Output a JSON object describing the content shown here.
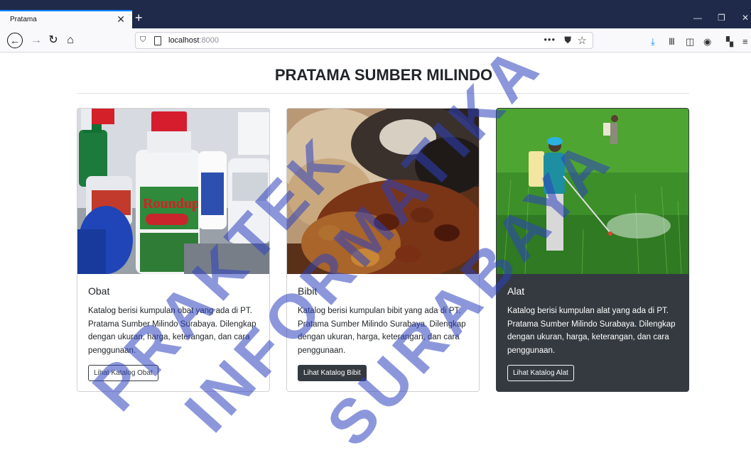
{
  "browser": {
    "tab_title": "Pratama",
    "url_host": "localhost",
    "url_port": ":8000",
    "accent": "#0a84ff"
  },
  "page": {
    "title": "PRATAMA SUMBER MILINDO"
  },
  "cards": [
    {
      "title": "Obat",
      "text": "Katalog berisi kumpulan obat yang ada di PT. Pratama Sumber Milindo Surabaya. Dilengkap dengan ukuran, harga, keterangan, dan cara penggunaan.",
      "button": "Lihat Katalog Obat",
      "image": "pesticide-bottles"
    },
    {
      "title": "Bibit",
      "text": "Katalog berisi kumpulan bibit yang ada di PT. Pratama Sumber Milindo Surabaya. Dilengkap dengan ukuran, harga, keterangan, dan cara penggunaan.",
      "button": "Lihat Katalog Bibit",
      "image": "seeds-pile"
    },
    {
      "title": "Alat",
      "text": "Katalog berisi kumpulan alat yang ada di PT. Pratama Sumber Milindo Surabaya. Dilengkap dengan ukuran, harga, keterangan, dan cara penggunaan.",
      "button": "Lihat Katalog Alat",
      "image": "farmer-spraying-rice-field"
    }
  ],
  "watermark": {
    "lines": [
      "PRAKTEK",
      "INFORMATIKA",
      "SURABAYA"
    ]
  },
  "colors": {
    "dark": "#343a40",
    "watermark": "#2d41be"
  }
}
